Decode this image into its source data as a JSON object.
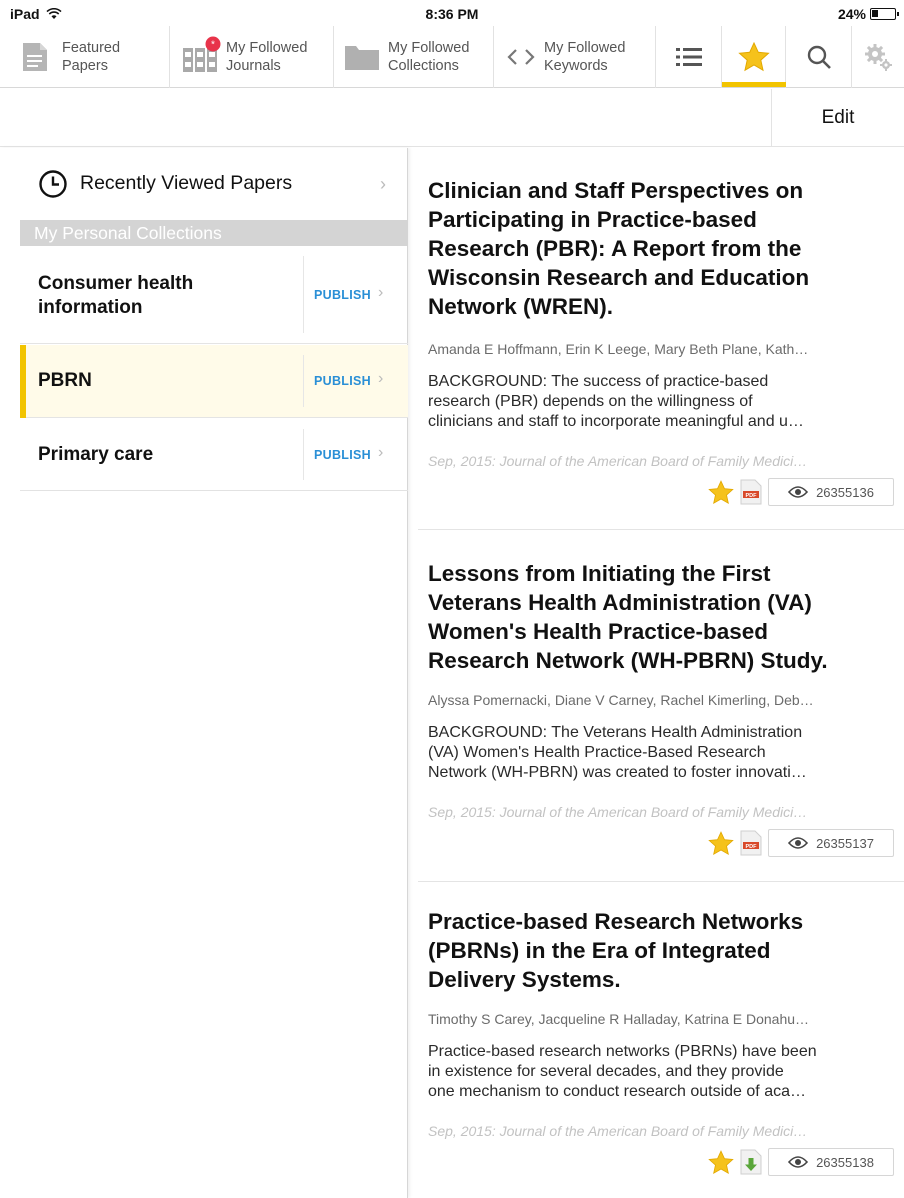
{
  "status": {
    "device": "iPad",
    "time": "8:36 PM",
    "battery": "24%"
  },
  "toolbar": {
    "featured": {
      "line1": "Featured",
      "line2": "Papers"
    },
    "journals": {
      "line1": "My Followed",
      "line2": "Journals"
    },
    "collections": {
      "line1": "My Followed",
      "line2": "Collections"
    },
    "keywords": {
      "line1": "My Followed",
      "line2": "Keywords"
    }
  },
  "editbar": {
    "edit_label": "Edit"
  },
  "sidebar": {
    "recent_label": "Recently Viewed Papers",
    "section_header": "My Personal Collections",
    "publish_label": "PUBLISH",
    "collections": [
      {
        "line1": "Consumer health",
        "line2": "information"
      },
      {
        "line1": "PBRN"
      },
      {
        "line1": "Primary care"
      }
    ]
  },
  "papers": [
    {
      "title": [
        "Clinician and Staff Perspectives on",
        "Participating in Practice-based",
        "Research (PBR): A Report from the",
        "Wisconsin Research and Education",
        "Network (WREN)."
      ],
      "authors": "Amanda E Hoffmann, Erin K Leege, Mary Beth Plane, Kath…",
      "abstract": [
        "BACKGROUND: The success of practice-based",
        "research (PBR) depends on the willingness of",
        "clinicians and staff to incorporate meaningful and u…"
      ],
      "journal": "Sep, 2015: Journal of the American Board of Family Medici…",
      "pmid": "26355136"
    },
    {
      "title": [
        "Lessons from Initiating the First",
        "Veterans Health Administration (VA)",
        "Women's Health Practice-based",
        "Research Network (WH-PBRN) Study."
      ],
      "authors": "Alyssa Pomernacki, Diane V Carney, Rachel Kimerling, Deb…",
      "abstract": [
        "BACKGROUND: The Veterans Health Administration",
        "(VA) Women's Health Practice-Based Research",
        "Network (WH-PBRN) was created to foster innovati…"
      ],
      "journal": "Sep, 2015: Journal of the American Board of Family Medici…",
      "pmid": "26355137"
    },
    {
      "title": [
        "Practice-based Research Networks",
        "(PBRNs) in the Era of Integrated",
        "Delivery Systems."
      ],
      "authors": "Timothy S Carey, Jacqueline R Halladay, Katrina E Donahu…",
      "abstract": [
        "Practice-based research networks (PBRNs) have been",
        "in existence for several decades, and they provide",
        "one mechanism to conduct research outside of aca…"
      ],
      "journal": "Sep, 2015: Journal of the American Board of Family Medici…",
      "pmid": "26355138"
    }
  ],
  "colors": {
    "accent": "#f2c400",
    "publish": "#2a8fd6",
    "active_row": "#fffbe9",
    "section_header": "#d4d4d4"
  },
  "icons": [
    "wifi-icon",
    "battery-icon",
    "document-icon",
    "journals-icon",
    "notification-badge-icon",
    "folder-icon",
    "code-brackets-icon",
    "list-icon",
    "star-icon",
    "search-icon",
    "gear-icon",
    "clock-icon",
    "chevron-right-icon",
    "pdf-icon",
    "download-icon",
    "eye-icon"
  ]
}
